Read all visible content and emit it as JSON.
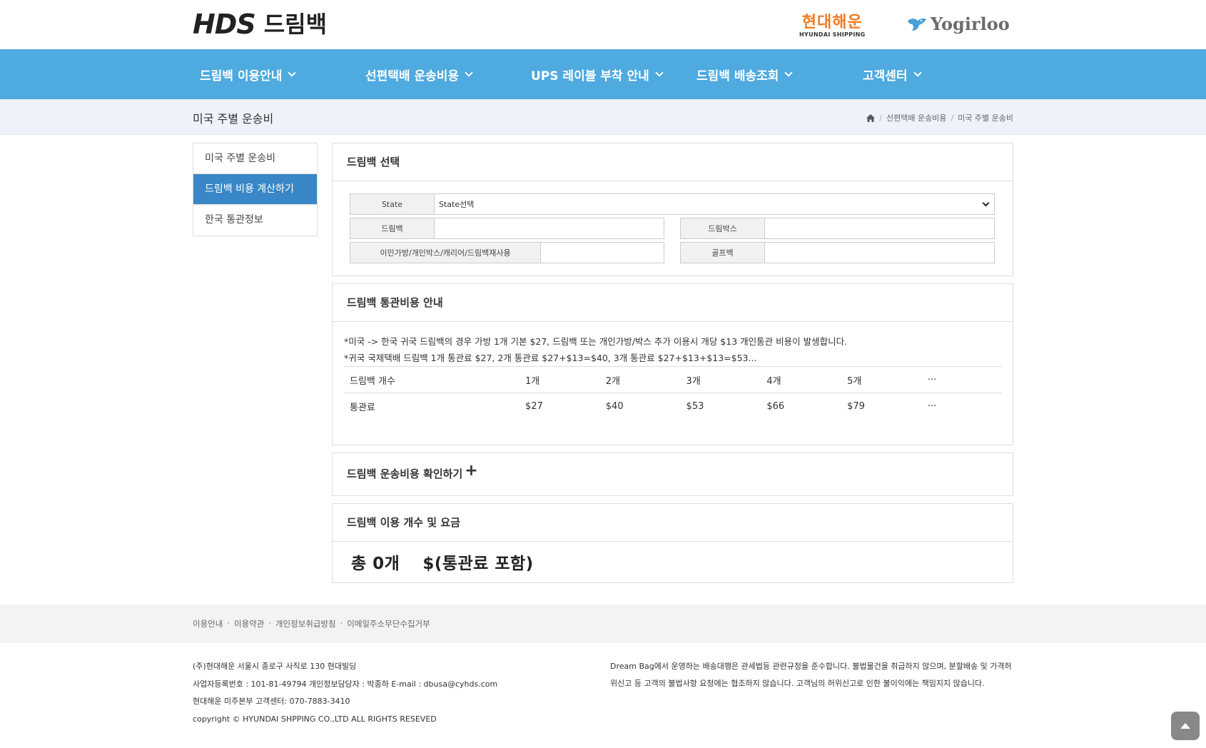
{
  "header": {
    "logo_mark": "HDS",
    "logo_text": "드림백",
    "partner1_main": "현대해운",
    "partner1_sub": "HYUNDAI SHIPPING",
    "partner2": "Yogirloo"
  },
  "nav": {
    "items": [
      {
        "label": "드림백 이용안내"
      },
      {
        "label": "선편택배 운송비용"
      },
      {
        "label": "UPS 레이블 부착 안내"
      },
      {
        "label": "드림백 배송조회"
      },
      {
        "label": "고객센터"
      }
    ]
  },
  "subheader": {
    "title": "미국 주별 운송비",
    "breadcrumb": [
      "선편택배 운송비용",
      "미국 주별 운송비"
    ],
    "separator": "/"
  },
  "sidebar": {
    "items": [
      {
        "label": "미국 주별 운송비"
      },
      {
        "label": "드림백 비용 계산하기"
      },
      {
        "label": "한국 통관정보"
      }
    ]
  },
  "select_panel": {
    "title": "드림백 선택",
    "state_label": "State",
    "state_value": "State선택",
    "dreambag_label": "드림백",
    "dreambag_value": "",
    "dreambox_label": "드림박스",
    "dreambox_value": "",
    "reuse_label": "이민가방/개인박스/캐리어/드림백재사용",
    "reuse_value": "",
    "golfbag_label": "골프백",
    "golfbag_value": ""
  },
  "customs_panel": {
    "title": "드림백 통관비용 안내",
    "notice1": "*미국 -> 한국 귀국 드림백의 경우 가방 1개 기본 $27, 드림백 또는 개인가방/박스 추가 이용시 개당 $13 개인통관 비용이 발생합니다.",
    "notice2": "*귀국 국제택배 드림백 1개 통관료 $27, 2개 통관료 $27+$13=$40, 3개 통관료 $27+$13+$13=$53...",
    "table": {
      "row1_head": "드림백 개수",
      "counts": [
        "1개",
        "2개",
        "3개",
        "4개",
        "5개",
        "···"
      ],
      "row2_head": "통관료",
      "fees": [
        "$27",
        "$40",
        "$53",
        "$66",
        "$79",
        "···"
      ]
    }
  },
  "shipping_panel": {
    "title": "드림백 운송비용 확인하기",
    "expand_symbol": "+"
  },
  "summary_panel": {
    "title": "드림백 이용 개수 및 요금",
    "total_text": "총 0개 　$(통관료 포함)"
  },
  "footer": {
    "links": [
      "이용안내",
      "이용약관",
      "개인정보취급방침",
      "이메일주소무단수집거부"
    ],
    "link_separator": "·",
    "info_lines": [
      "(주)현대해운 서울시 종로구 사직로 130 현대빌딩",
      "사업자등록번호 : 101-81-49794 개인정보담당자 : 박종하 E-mail : dbusa@cyhds.com",
      "현대해운 미주본부 고객센터: 070-7883-3410",
      "copyright © HYUNDAI SHPPING CO.,LTD ALL RIGHTS RESEVED"
    ],
    "note": "Dream Bag에서 운영하는 배송대행은 관세법등 관련규정을 준수합니다. 불법물건을 취급하지 않으며, 분할배송 및 가격허위신고 등 고객의 불법사항 요청에는 협조하지 않습니다. 고객님의 허위신고로 인한 불이익에는 책임지지 않습니다."
  },
  "colors": {
    "nav_bg": "#4eaadf",
    "sidebar_active": "#3a87c8",
    "partner_orange": "#f47b20"
  }
}
